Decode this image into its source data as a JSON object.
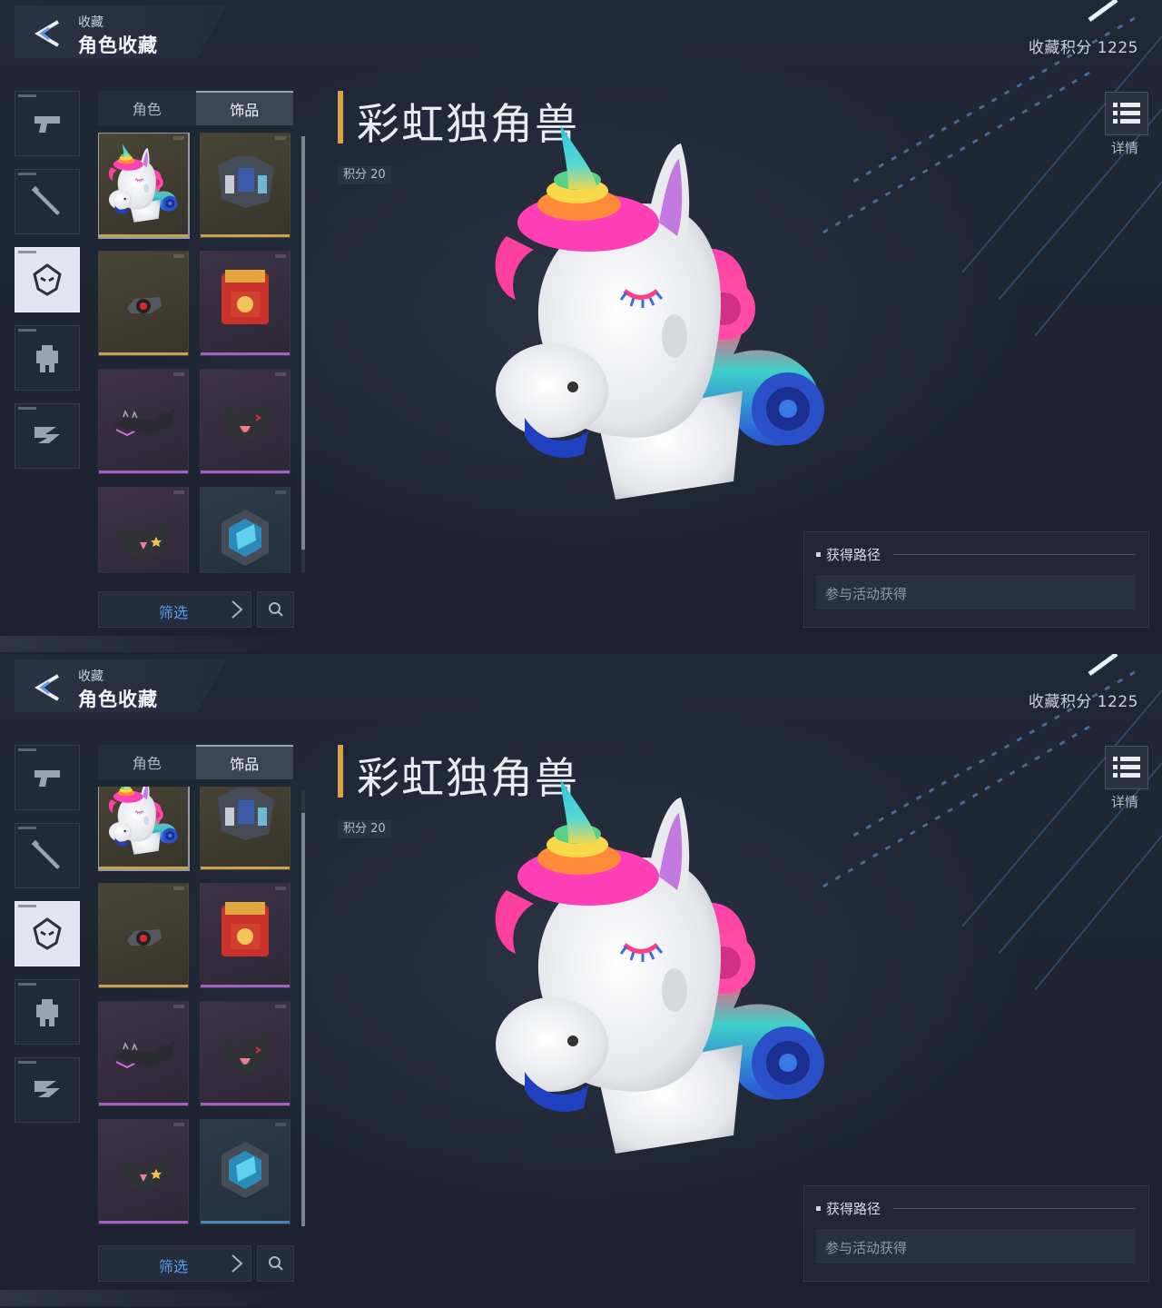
{
  "header": {
    "subtitle": "收藏",
    "title": "角色收藏"
  },
  "collection_points": "收藏积分 1225",
  "categories": [
    {
      "name": "weapon",
      "icon": "pistol-icon",
      "active": false
    },
    {
      "name": "melee",
      "icon": "baton-icon",
      "active": false
    },
    {
      "name": "character",
      "icon": "character-head-icon",
      "active": true
    },
    {
      "name": "mech",
      "icon": "mech-robot-icon",
      "active": false
    },
    {
      "name": "vehicle",
      "icon": "aircraft-icon",
      "active": false
    }
  ],
  "tabs": [
    {
      "label": "角色",
      "active": false
    },
    {
      "label": "饰品",
      "active": true
    }
  ],
  "items": [
    {
      "name": "unicorn-head",
      "rarity": "gold",
      "selected": true
    },
    {
      "name": "tactical-armor",
      "rarity": "gold",
      "selected": false
    },
    {
      "name": "red-eye-device",
      "rarity": "gold",
      "selected": false
    },
    {
      "name": "red-backpack",
      "rarity": "purple",
      "selected": false
    },
    {
      "name": "spiked-visor",
      "rarity": "purple",
      "selected": false
    },
    {
      "name": "black-mask-tongue",
      "rarity": "purple",
      "selected": false
    },
    {
      "name": "black-mask-star",
      "rarity": "purple",
      "selected": false
    },
    {
      "name": "hex-shield",
      "rarity": "blue",
      "selected": false
    }
  ],
  "filter_label": "筛选",
  "selected_item": {
    "name": "彩虹独角兽",
    "points": "积分 20"
  },
  "detail_label": "详情",
  "source": {
    "title": "获得路径",
    "text": "参与活动获得"
  },
  "colors": {
    "accent": "#d8a24a",
    "filter_text": "#5a9cf0",
    "rarity_gold": "#c9a054",
    "rarity_purple": "#a45fc2",
    "rarity_blue": "#4a83b4"
  }
}
